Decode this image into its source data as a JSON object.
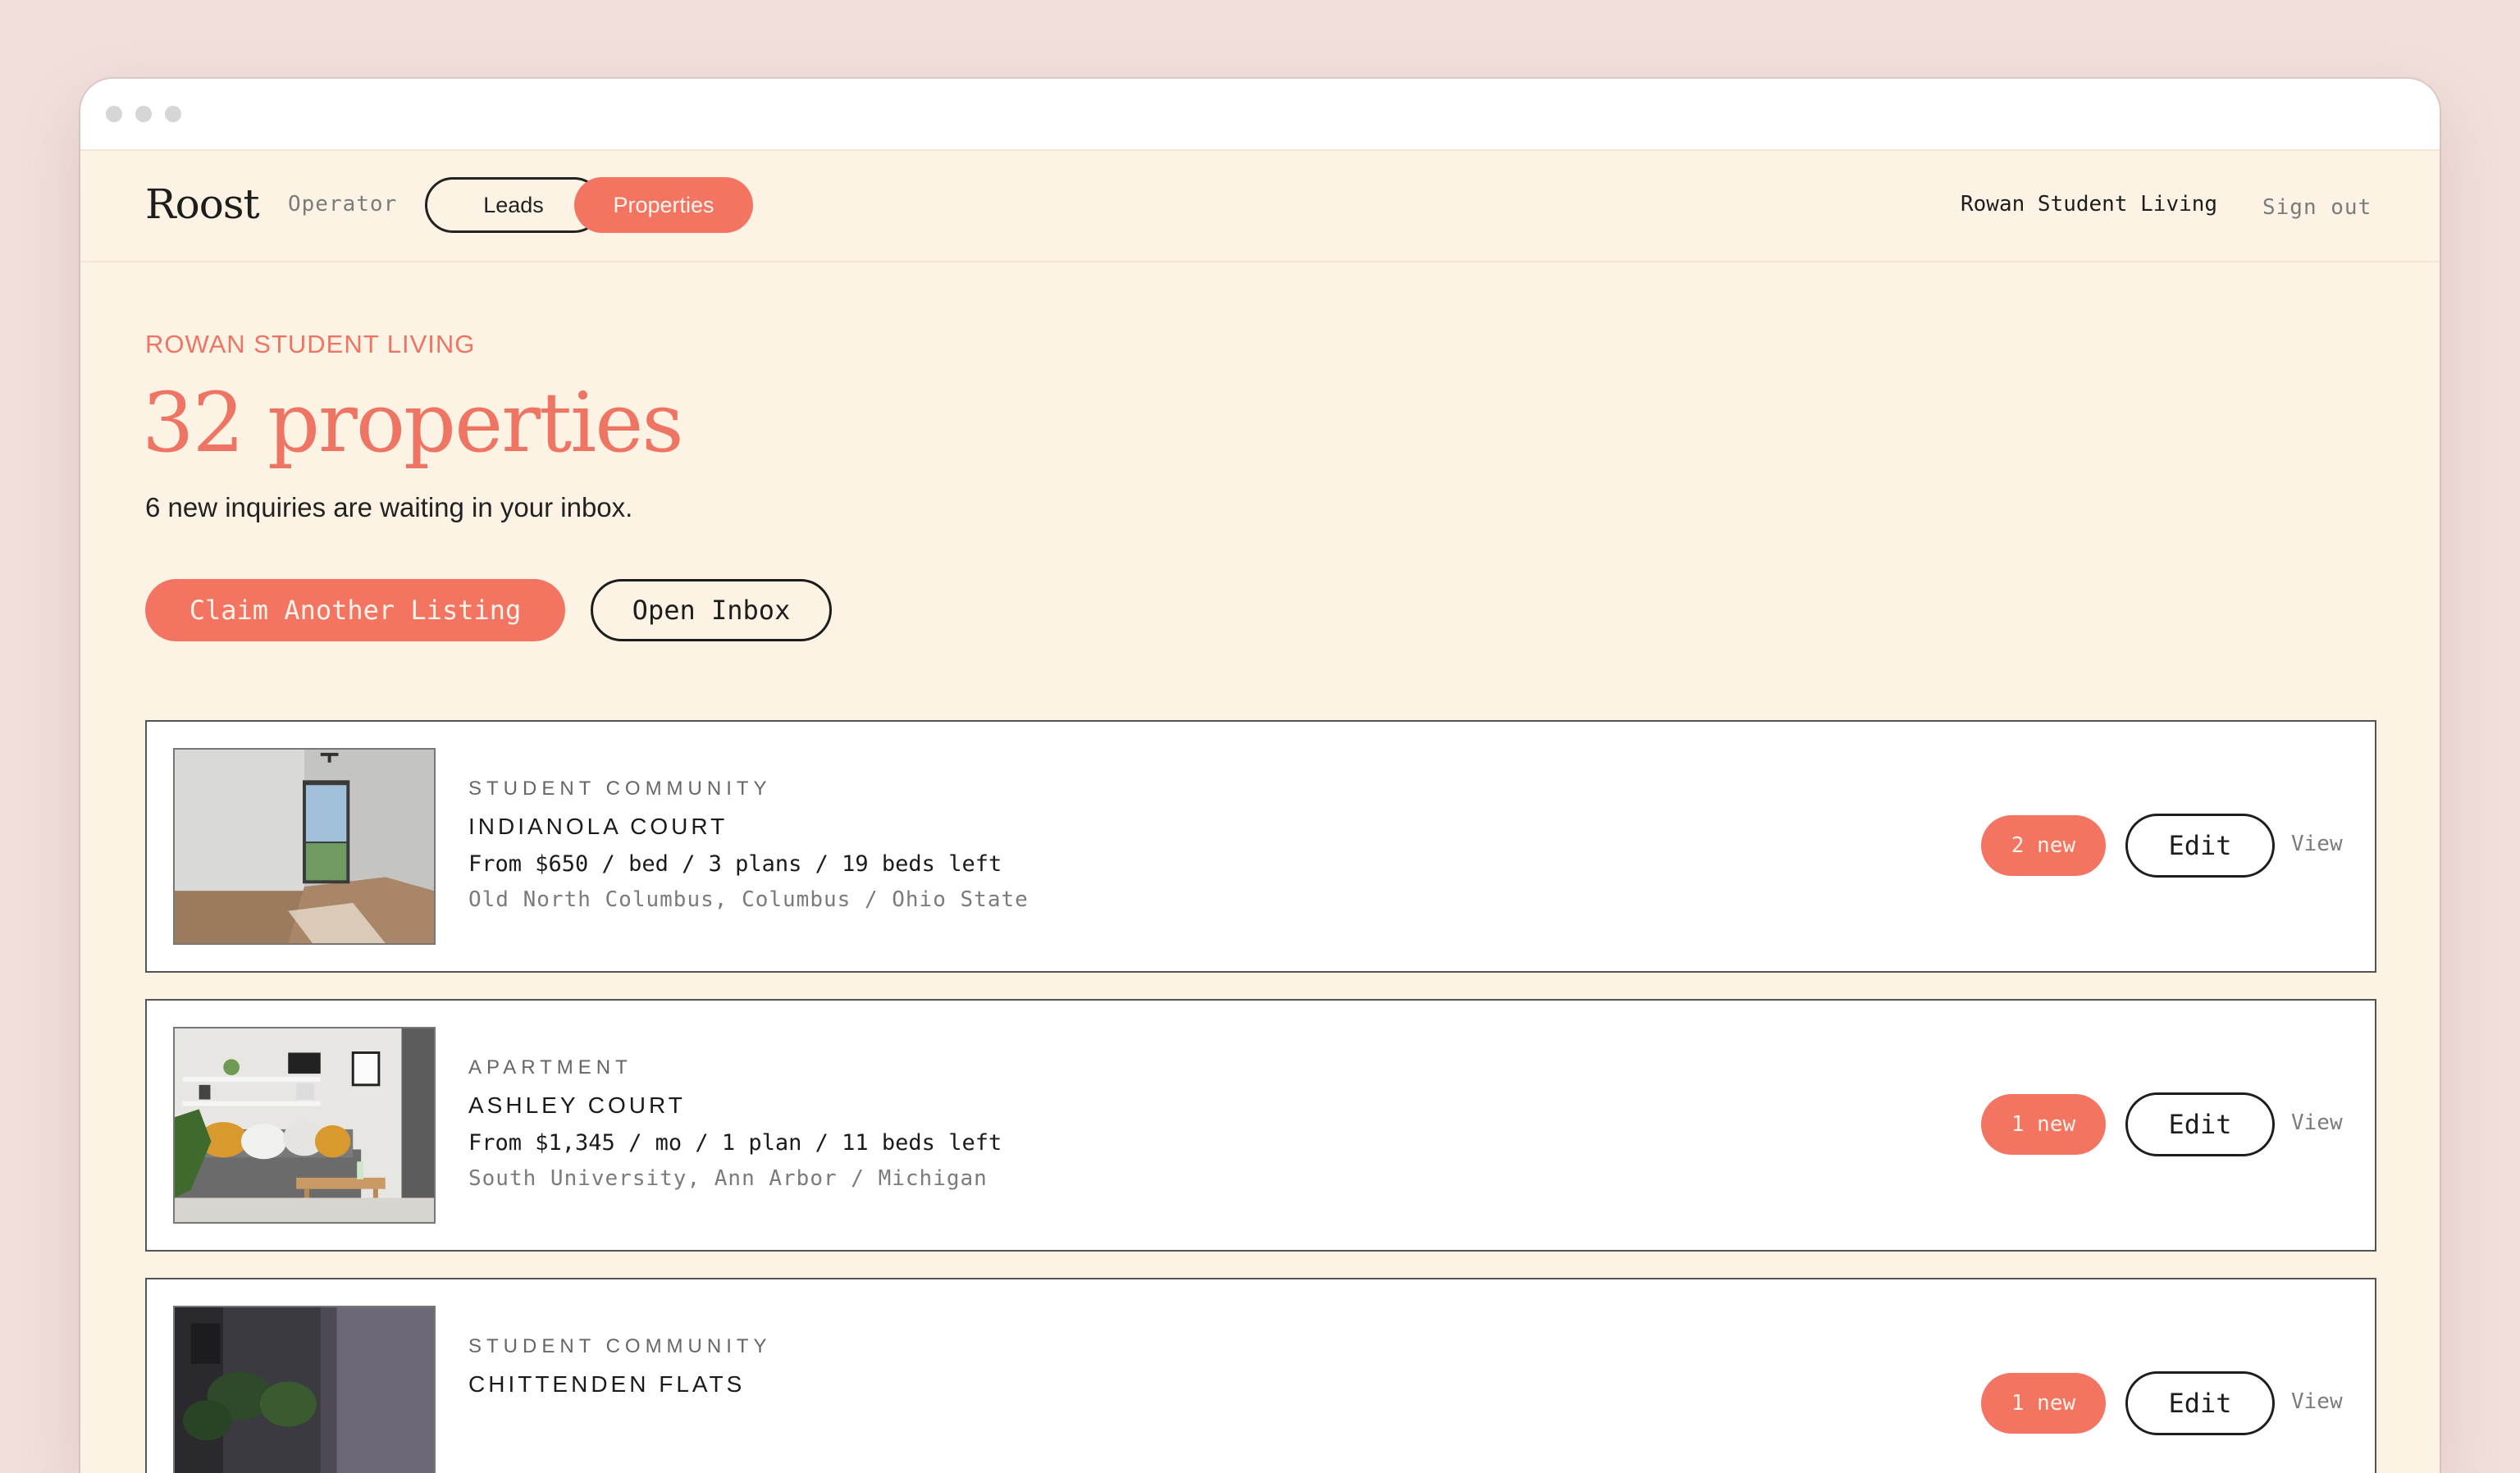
{
  "nav": {
    "brand": "Roost",
    "role": "Operator",
    "tabs": [
      {
        "label": "Leads",
        "active": false
      },
      {
        "label": "Properties",
        "active": true
      }
    ],
    "org_name": "Rowan Student Living",
    "sign_out": "Sign out"
  },
  "header": {
    "eyebrow": "ROWAN STUDENT LIVING",
    "title": "32 properties",
    "subtitle": "6 new inquiries are waiting in your inbox.",
    "primary_button": "Claim Another Listing",
    "secondary_button": "Open Inbox"
  },
  "properties": [
    {
      "type": "STUDENT COMMUNITY",
      "name": "INDIANOLA COURT",
      "meta": "From $650 / bed / 3 plans / 19 beds left",
      "location": "Old North Columbus, Columbus / Ohio State",
      "badge": "2 new",
      "edit": "Edit",
      "view": "View"
    },
    {
      "type": "APARTMENT",
      "name": "ASHLEY COURT",
      "meta": "From $1,345 / mo / 1 plan / 11 beds left",
      "location": "South University, Ann Arbor / Michigan",
      "badge": "1 new",
      "edit": "Edit",
      "view": "View"
    },
    {
      "type": "STUDENT COMMUNITY",
      "name": "CHITTENDEN FLATS",
      "meta": "",
      "location": "",
      "badge": "1 new",
      "edit": "Edit",
      "view": "View"
    }
  ],
  "colors": {
    "accent": "#f47462",
    "page_bg": "#fdf3e5",
    "outer_bg": "#f1dfdb",
    "ink": "#1d1d1d"
  }
}
